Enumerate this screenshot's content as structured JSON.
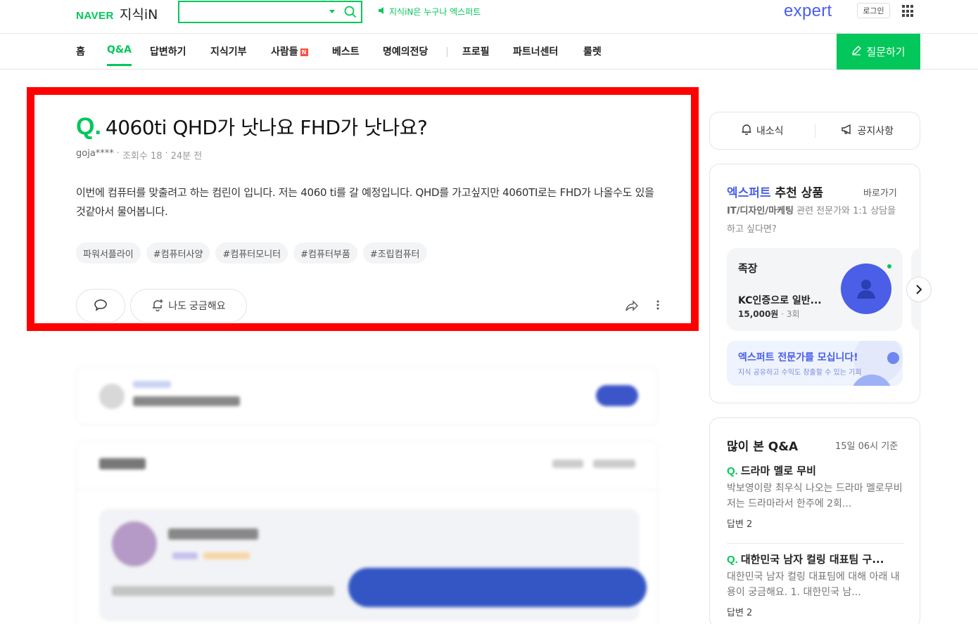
{
  "header": {
    "brand": "NAVER",
    "service": "지식iN",
    "search": {
      "value": "",
      "placeholder": ""
    },
    "notice": "지식iN은 누구나 엑스퍼트",
    "expert_logo": "expert",
    "login_label": "로그인"
  },
  "nav": {
    "items": [
      {
        "label": "홈"
      },
      {
        "label": "Q&A",
        "active": true
      },
      {
        "label": "답변하기"
      },
      {
        "label": "지식기부"
      },
      {
        "label": "사람들",
        "badge": "N"
      },
      {
        "label": "베스트"
      },
      {
        "label": "명예의전당"
      },
      {
        "label": "프로필"
      },
      {
        "label": "파트너센터"
      },
      {
        "label": "룰렛"
      }
    ],
    "ask_label": "질문하기"
  },
  "question": {
    "q_mark": "Q.",
    "title": "4060ti QHD가 낫나요 FHD가 낫나요?",
    "author": "goja****",
    "views": "조회수 18",
    "time": "24분 전",
    "body": "이번에 컴퓨터를 맞출려고 하는 컴린이 입니다. 저는 4060 ti를 갈 예정입니다. QHD를 가고싶지만 4060TI로는 FHD가 나올수도 있을것같아서 물어봅니다.",
    "tags": [
      "파워서플라이",
      "#컴퓨터사양",
      "#컴퓨터모니터",
      "#컴퓨터부품",
      "#조립컴퓨터"
    ],
    "curious_label": "나도 궁금해요"
  },
  "sidebar": {
    "tabs": {
      "news": "내소식",
      "notice": "공지사항"
    },
    "expert": {
      "title_blue": "엑스퍼트",
      "title_rest": "추천 상품",
      "shortcut": "바로가기",
      "desc_category": "IT/디자인/마케팅",
      "desc_rest": "관련 전문가와 1:1 상담을 하고 싶다면?",
      "product": {
        "keyword": "족장",
        "name": "KC인증으로 일반...",
        "price": "15,000원",
        "count": "3회"
      },
      "recruit_title": "엑스퍼트 전문가를 모십니다!",
      "recruit_sub": "지식 공유하고 수익도 창출할 수 있는 기회"
    },
    "popular": {
      "title": "많이 본 Q&A",
      "time": "15일 06시 기준",
      "items": [
        {
          "q": "드라마 멜로 무비",
          "body": "박보영이랑 최우식 나오는 드라마 멜로무비 저는 드라마라서 한주에 2회...",
          "answers": "답변 2"
        },
        {
          "q": "대한민국 남자 컬링 대표팀 구...",
          "body": "대한민국 남자 컬링 대표팀에 대해 아래 내용이 궁금해요. 1. 대한민국 남...",
          "answers": "답변 2"
        }
      ]
    }
  },
  "colors": {
    "brand_green": "#03c75a",
    "expert_blue": "#4a5ee8",
    "highlight_red": "#ff0000"
  }
}
